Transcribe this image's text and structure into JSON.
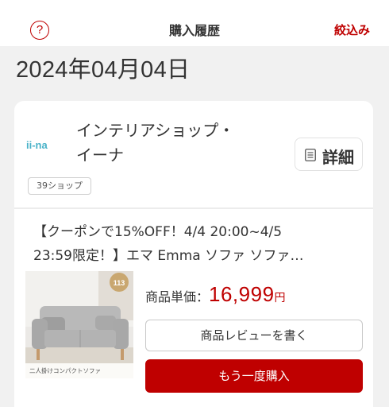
{
  "header": {
    "help_icon_glyph": "?",
    "title": "購入履歴",
    "filter_label": "絞込み"
  },
  "date_heading": "2024年04月04日",
  "order": {
    "shop": {
      "logo_text": "ii-na",
      "name_line1": "インテリアショップ・",
      "name_line2": "イーナ",
      "tag": "39ショップ"
    },
    "detail_label": "詳細",
    "product": {
      "name_line1": "【クーポンで15%OFF！4/4 20:00~4/5",
      "name_line2": "23:59限定！】エマ Emma ソファ ソファ…",
      "image_badge": "113",
      "image_caption": "二人掛けコンパクトソファ",
      "price_label": "商品単価：",
      "price_value": "16,999",
      "price_unit": "円"
    },
    "review_button": "商品レビューを書く",
    "rebuy_button": "もう一度購入"
  },
  "colors": {
    "accent": "#bf0000",
    "background": "#f1f1f1",
    "card": "#ffffff"
  }
}
